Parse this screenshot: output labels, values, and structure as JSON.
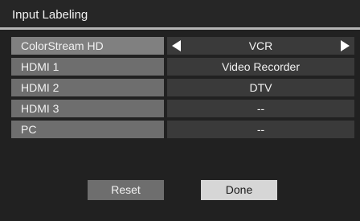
{
  "dialog": {
    "title": "Input Labeling"
  },
  "rows": [
    {
      "label": "ColorStream HD",
      "value": "VCR",
      "selected": true
    },
    {
      "label": "HDMI 1",
      "value": "Video Recorder"
    },
    {
      "label": "HDMI 2",
      "value": "DTV"
    },
    {
      "label": "HDMI 3",
      "value": "--"
    },
    {
      "label": "PC",
      "value": "--"
    }
  ],
  "buttons": {
    "reset_label": "Reset",
    "done_label": "Done"
  },
  "icons": {
    "left_arrow": "triangle-left-icon",
    "right_arrow": "triangle-right-icon"
  },
  "colors": {
    "background": "#212121",
    "label_background": "#6e6e6e",
    "value_background": "#3a3a3a",
    "focused_button": "#d6d6d6"
  }
}
